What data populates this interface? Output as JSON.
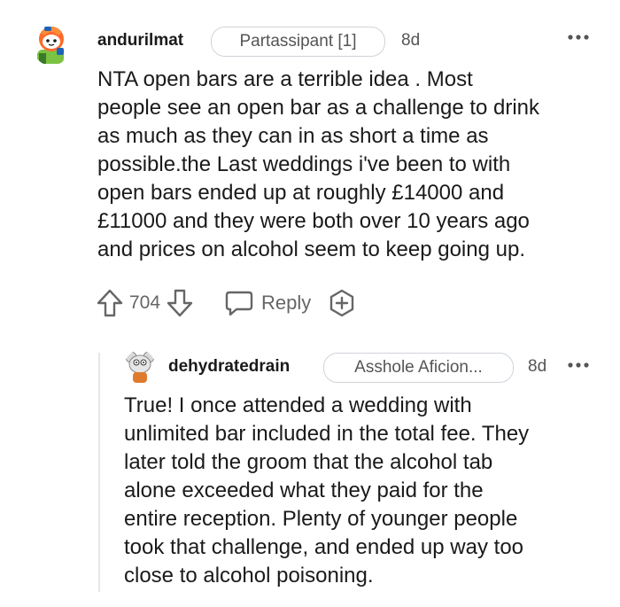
{
  "comment": {
    "username": "andurilmat",
    "flair": "Partassipant [1]",
    "age": "8d",
    "more_icon": "more-options-icon",
    "text": "NTA open bars are a terrible idea . Most\npeople see an open bar as a challenge to drink\nas much as they can in as short a time as\npossible.the Last weddings i've been to with\nopen bars ended up at roughly £14000 and\n£11000 and they were both over 10 years ago\nand prices on alcohol seem to keep going up.",
    "votes": "704",
    "reply_label": "Reply",
    "icons": {
      "upvote": "upvote-arrow-icon",
      "downvote": "downvote-arrow-icon",
      "reply": "speech-bubble-icon",
      "award": "add-award-icon"
    }
  },
  "reply": {
    "username": "dehydratedrain",
    "flair": "Asshole Aficion...",
    "age": "8d",
    "text": "True! I once attended a wedding with\nunlimited bar included in the total fee. They\nlater told the groom that the alcohol tab\nalone exceeded what they paid for the\nentire reception. Plenty of younger people\ntook that challenge, and ended up way too\nclose to alcohol poisoning."
  },
  "colors": {
    "text": "#1a1a1b",
    "muted": "#666666",
    "flair_border": "#cfd4d9",
    "thread_line": "#e5e7ea"
  }
}
